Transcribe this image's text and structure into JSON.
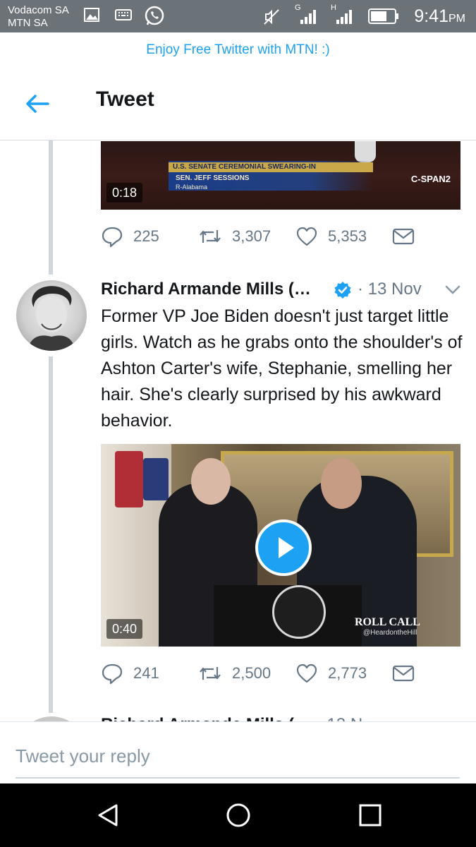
{
  "status_bar": {
    "carrier_line1": "Vodacom SA",
    "carrier_line2": "MTN SA",
    "net1": "G",
    "net2": "H",
    "time": "9:41",
    "ampm": "PM"
  },
  "promo_banner": "Enjoy Free Twitter with MTN! :)",
  "header": {
    "title": "Tweet"
  },
  "prev_tweet": {
    "media_duration": "0:18",
    "overlay_title": "U.S. SENATE CEREMONIAL SWEARING-IN",
    "overlay_name": "SEN. JEFF SESSIONS",
    "overlay_state": "R-Alabama",
    "channel_logo": "C-SPAN2",
    "replies": "225",
    "retweets": "3,307",
    "likes": "5,353"
  },
  "tweet": {
    "author": "Richard Armande Mills (…",
    "date": "· 13 Nov",
    "text": "Former VP Joe Biden doesn't just target little girls. Watch as he grabs onto the shoulder's of Ashton Carter's wife, Stephanie, smelling her hair. She's clearly surprised by his awkward behavior.",
    "media_duration": "0:40",
    "video_overlay_brand": "ROLL CALL",
    "video_overlay_handle": "@HeardontheHill",
    "replies": "241",
    "retweets": "2,500",
    "likes": "2,773"
  },
  "next_tweet": {
    "author": "Richard Armande Mills (",
    "date": "13 N"
  },
  "reply": {
    "placeholder": "Tweet your reply"
  },
  "colors": {
    "accent": "#1da1f2",
    "status_bar": "#6b7278",
    "muted": "#657786"
  }
}
